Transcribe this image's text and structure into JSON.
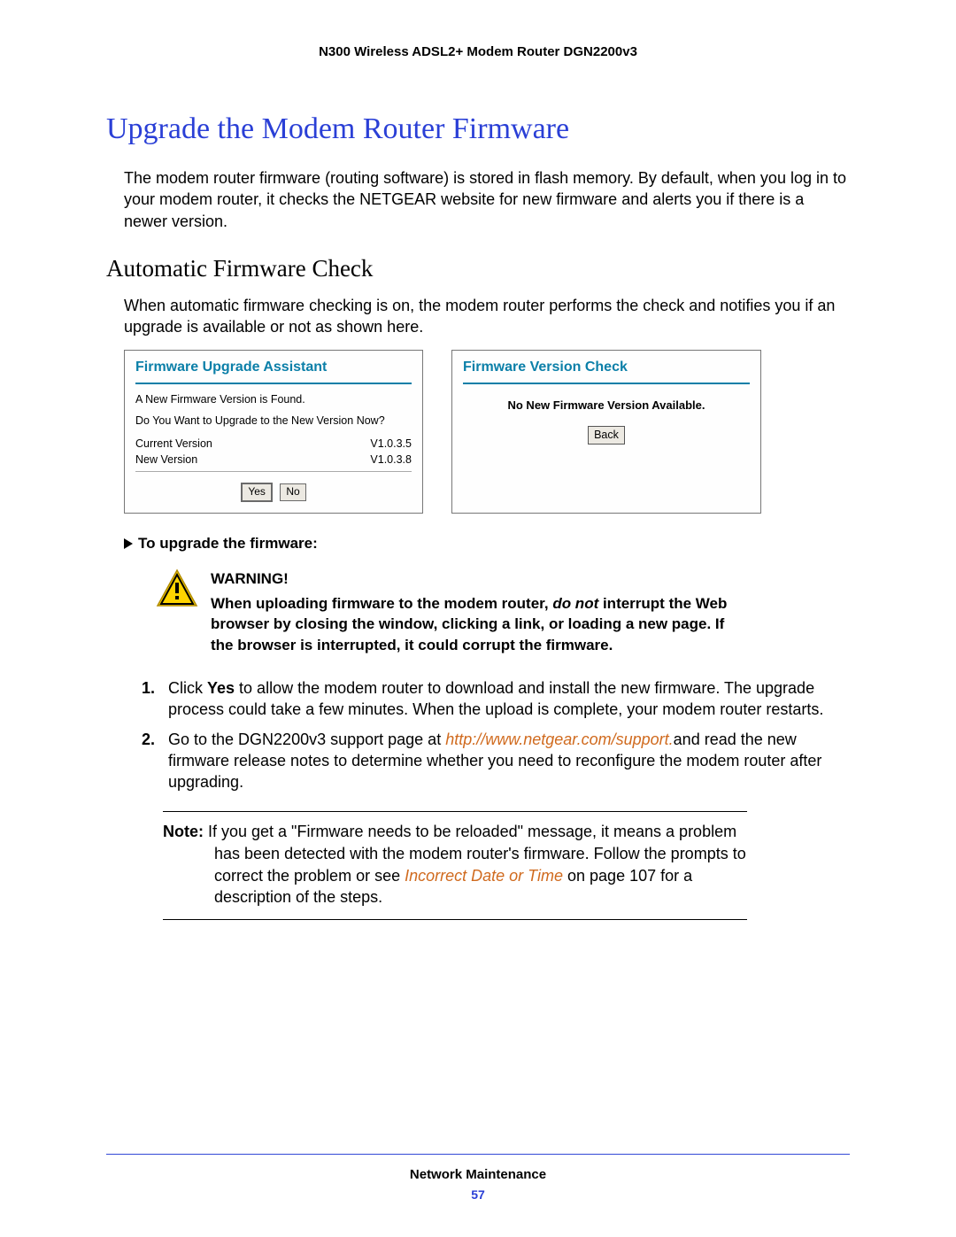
{
  "docHeader": "N300 Wireless ADSL2+ Modem Router DGN2200v3",
  "h1": "Upgrade the Modem Router Firmware",
  "intro": "The modem router firmware (routing software) is stored in flash memory. By default, when you log in to your modem router, it checks the NETGEAR website for new firmware and alerts you if there is a newer version.",
  "h2": "Automatic Firmware Check",
  "autoIntro": "When automatic firmware checking is on, the modem router performs the check and notifies you if an upgrade is available or not as shown here.",
  "panelLeft": {
    "title": "Firmware Upgrade Assistant",
    "msg1": "A New Firmware Version is Found.",
    "msg2": "Do You Want to Upgrade to the New Version Now?",
    "curLabel": "Current Version",
    "curVal": "V1.0.3.5",
    "newLabel": "New Version",
    "newVal": "V1.0.3.8",
    "yes": "Yes",
    "no": "No"
  },
  "panelRight": {
    "title": "Firmware Version Check",
    "msg": "No New Firmware Version Available.",
    "back": "Back"
  },
  "procedure": "To upgrade the firmware:",
  "warning": {
    "label": "WARNING!",
    "line1": "When uploading firmware to the modem router, ",
    "doNot": "do not",
    "line2": " interrupt the Web browser by closing the window, clicking a link, or loading a new page. If the browser is interrupted, it could corrupt the firmware."
  },
  "steps": {
    "s1num": "1.",
    "s1a": "Click ",
    "s1yes": "Yes",
    "s1b": " to allow the modem router to download and install the new firmware. The upgrade process could take a few minutes. When the upload is complete, your modem router restarts.",
    "s2num": "2.",
    "s2a": "Go to the DGN2200v3 support page at ",
    "s2link": "http://www.netgear.com/support.",
    "s2b": "and read the new firmware release notes to determine whether you need to reconfigure the modem router after upgrading."
  },
  "note": {
    "label": "Note:",
    "text1": "  If you get a \"Firmware needs to be reloaded\" message, it means a problem has been detected with the modem router's firmware. Follow the prompts to correct the problem or see ",
    "link": "Incorrect Date or Time",
    "text2": " on page 107 for a description of the steps."
  },
  "footer": {
    "title": "Network Maintenance",
    "page": "57"
  }
}
